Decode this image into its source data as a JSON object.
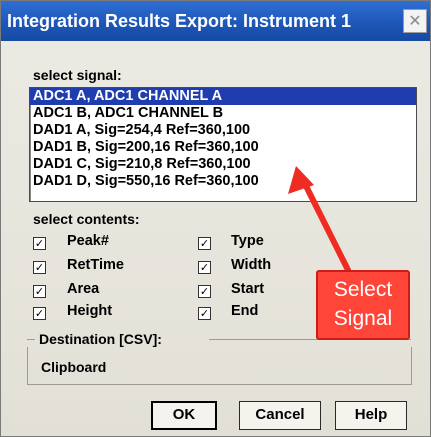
{
  "window": {
    "title": "Integration Results Export: Instrument 1",
    "close_glyph": "✕"
  },
  "signal": {
    "label": "select signal:",
    "items": [
      "ADC1 A, ADC1 CHANNEL A",
      "ADC1 B, ADC1 CHANNEL B",
      "DAD1 A, Sig=254,4 Ref=360,100",
      "DAD1 B, Sig=200,16 Ref=360,100",
      "DAD1 C, Sig=210,8 Ref=360,100",
      "DAD1 D, Sig=550,16 Ref=360,100"
    ],
    "selected_index": 0
  },
  "contents": {
    "label": "select contents:",
    "check_glyph": "✓",
    "left": [
      {
        "label": "Peak#",
        "checked": true
      },
      {
        "label": "RetTime",
        "checked": true
      },
      {
        "label": "Area",
        "checked": true
      },
      {
        "label": "Height",
        "checked": true
      }
    ],
    "right": [
      {
        "label": "Type",
        "checked": true
      },
      {
        "label": "Width",
        "checked": true
      },
      {
        "label": "Start",
        "checked": true
      },
      {
        "label": "End",
        "checked": true
      }
    ]
  },
  "destination": {
    "label": "Destination [CSV]:",
    "value": "Clipboard"
  },
  "buttons": {
    "ok": "OK",
    "cancel": "Cancel",
    "help": "Help"
  },
  "annotation": {
    "line1": "Select",
    "line2": "Signal",
    "color": "#ff4438"
  }
}
